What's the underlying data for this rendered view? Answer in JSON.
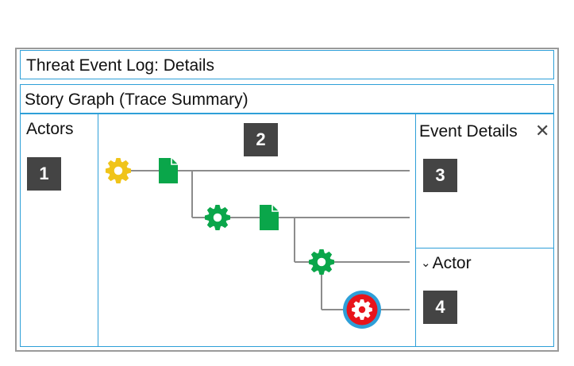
{
  "title_bar": {
    "label": "Threat Event Log: Details"
  },
  "subtitle_bar": {
    "label": "Story Graph (Trace Summary)"
  },
  "actors_panel": {
    "label": "Actors",
    "badge": "1"
  },
  "graph_panel": {
    "badge": "2",
    "nodes": [
      {
        "name": "process-node-yellow-gear-icon",
        "kind": "gear",
        "color": "#f0c419",
        "status": "normal"
      },
      {
        "name": "file-node-green-document-icon",
        "kind": "file",
        "color": "#0aa64a",
        "status": "normal"
      },
      {
        "name": "process-node-green-gear-icon",
        "kind": "gear",
        "color": "#0aa64a",
        "status": "normal"
      },
      {
        "name": "file-node-green-document-icon-2",
        "kind": "file",
        "color": "#0aa64a",
        "status": "normal"
      },
      {
        "name": "process-node-green-gear-icon-2",
        "kind": "gear",
        "color": "#0aa64a",
        "status": "normal"
      },
      {
        "name": "threat-node-red-gear-icon",
        "kind": "gear",
        "color": "#e8141b",
        "status": "selected"
      }
    ],
    "line_color": "#8c8c8c",
    "selected_ring_color": "#2e9fd8"
  },
  "event_details_panel": {
    "label": "Event Details",
    "close_icon": "close-icon",
    "badge": "3"
  },
  "actor_section": {
    "label": "Actor",
    "toggle_icon": "chevron-down-icon",
    "badge": "4"
  },
  "colors": {
    "border": "#2e9fd8",
    "outer_border": "#9a9a9a",
    "badge_bg": "#444444",
    "badge_text": "#ffffff"
  }
}
